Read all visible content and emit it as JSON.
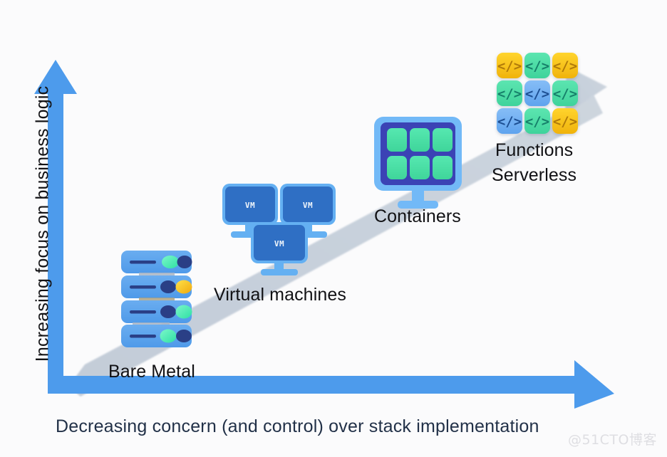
{
  "diagram": {
    "title_implicit": "Cloud abstraction spectrum",
    "background_color": "#fbfbfc",
    "axes": {
      "y_label": "Increasing focus on business logic",
      "x_label": "Decreasing concern (and control) over stack implementation",
      "arrow_color": "#4d9bec",
      "x_label_color": "#223148",
      "y_label_color": "#141417"
    },
    "trend_band": {
      "name": "progression-arrow",
      "color": "#b9c4d2",
      "direction": "bottom-left-to-top-right"
    },
    "stages": [
      {
        "id": "bare-metal",
        "label": "Bare Metal",
        "icon": "server-rack-icon",
        "units": 4,
        "unit_color": "#5aa3ec",
        "bar_color": "#2a3f86",
        "leds": [
          [
            "#49f0c0",
            "#2a3f86"
          ],
          [
            "#2a3f86",
            "#f5c518"
          ],
          [
            "#2a3f86",
            "#6cf0b4"
          ],
          [
            "#6cf0b4",
            "#2a3f86"
          ]
        ]
      },
      {
        "id": "virtual-machines",
        "label": "Virtual machines",
        "icon": "monitor-vm-icon",
        "count": 3,
        "screen_text": "VM",
        "screen_color": "#2f6fc4",
        "frame_color": "#64b0f2"
      },
      {
        "id": "containers",
        "label": "Containers",
        "icon": "monitor-grid-icon",
        "tiles": 6,
        "tile_color": "#4ee0a6",
        "screen_color": "#3b43b5",
        "frame_color": "#72b9f7"
      },
      {
        "id": "functions-serverless",
        "label_line1": "Functions",
        "label_line2": "Serverless",
        "icon": "code-tile-grid-icon",
        "glyph": "</>",
        "tiles": [
          [
            "#f6c324",
            "#4edba6",
            "#f6c324"
          ],
          [
            "#4edba6",
            "#72b0f0",
            "#4edba6"
          ],
          [
            "#72b0f0",
            "#4edba6",
            "#f6c324"
          ]
        ]
      }
    ],
    "watermark": "@51CTO博客"
  }
}
